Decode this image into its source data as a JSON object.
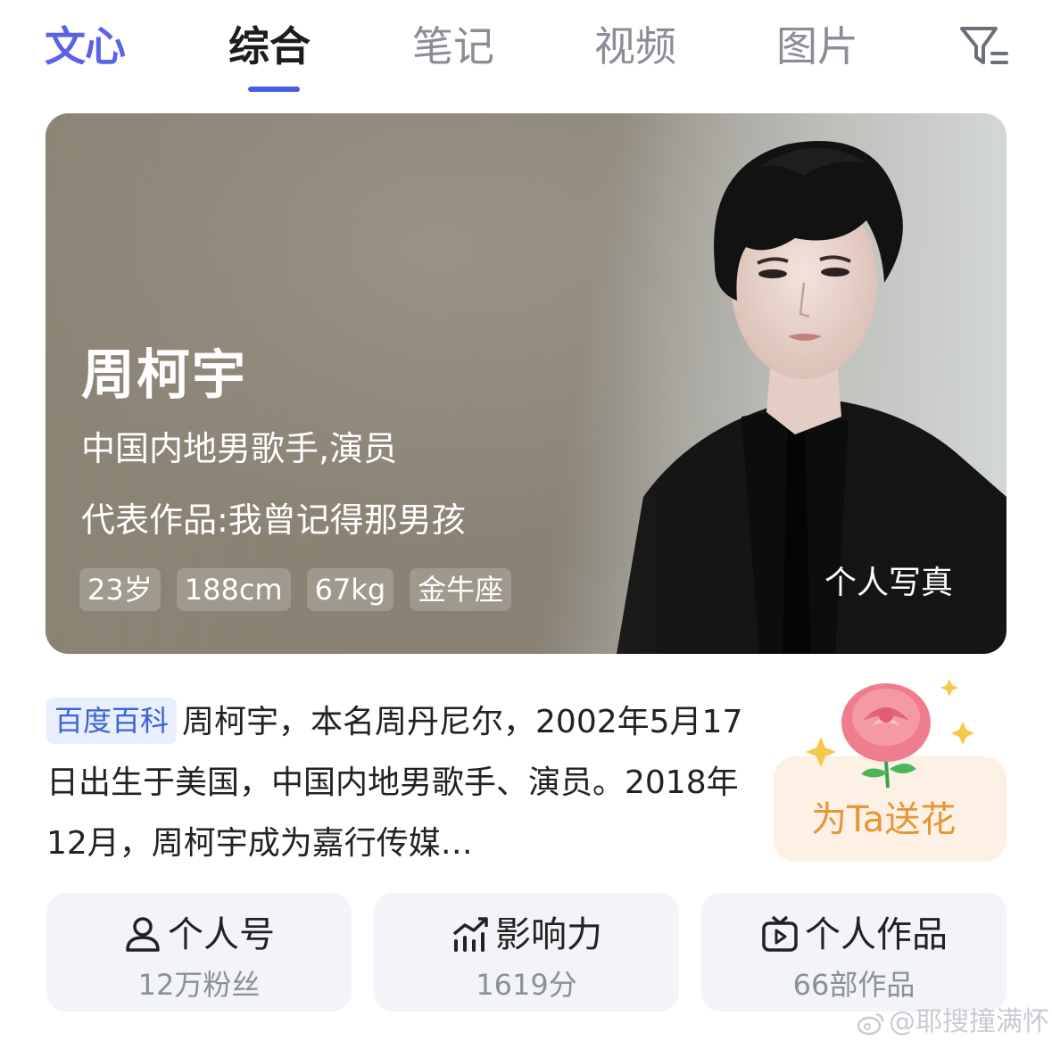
{
  "tabs": {
    "brand": "文心",
    "items": [
      "综合",
      "笔记",
      "视频",
      "图片"
    ],
    "active_index": 0
  },
  "hero": {
    "name": "周柯宇",
    "subtitle": "中国内地男歌手,演员",
    "works": "代表作品:我曾记得那男孩",
    "chips": [
      "23岁",
      "188cm",
      "67kg",
      "金牛座"
    ],
    "photo_link": "个人写真"
  },
  "summary": {
    "tag": "百度百科",
    "text": "周柯宇，本名周丹尼尔，2002年5月17日出生于美国，中国内地男歌手、演员。2018年12月，周柯宇成为嘉行传媒…"
  },
  "flower": {
    "label": "为Ta送花"
  },
  "cards": [
    {
      "title": "个人号",
      "sub": "12万粉丝",
      "icon": "person-icon"
    },
    {
      "title": "影响力",
      "sub": "1619分",
      "icon": "trend-chart-icon"
    },
    {
      "title": "个人作品",
      "sub": "66部作品",
      "icon": "video-play-icon"
    }
  ],
  "watermark": "@耶搜撞满怀",
  "colors": {
    "brand": "#5a62e8",
    "accent_underline": "#4b5ae8",
    "tag_bg": "#e8efff",
    "tag_text": "#3b63d8",
    "flower_text": "#e69636",
    "card_bg": "#f2f4f8"
  }
}
